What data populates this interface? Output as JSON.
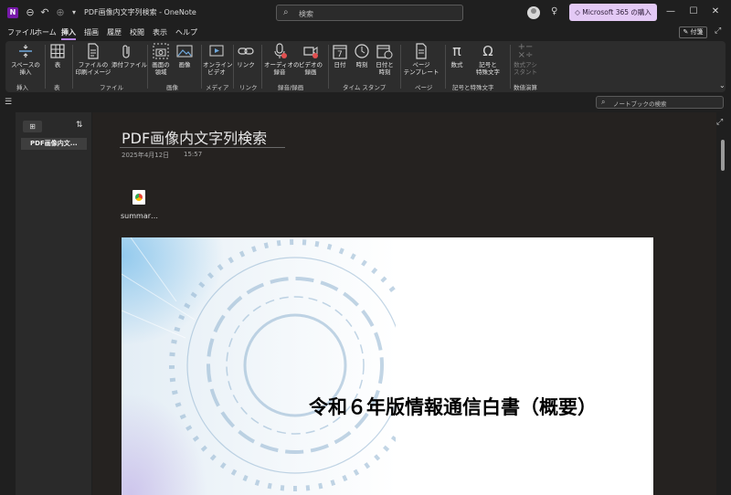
{
  "titlebar": {
    "doc_title": "PDF画像内文字列検索  -  OneNote",
    "search_placeholder": "検索",
    "buy_label": "Microsoft 365 の購入",
    "app_logo_letter": "N"
  },
  "menu": {
    "tabs": [
      "ファイル",
      "ホーム",
      "挿入",
      "描画",
      "履歴",
      "校閲",
      "表示",
      "ヘルプ"
    ],
    "active_tab": "挿入",
    "note_label": "付箋"
  },
  "ribbon": {
    "buttons": {
      "insert_space": "スペースの\n挿入",
      "table": "表",
      "printout": "ファイルの\n印刷イメージ",
      "attach": "添付ファイル",
      "screen_clip": "画面の\n領域",
      "picture": "画像",
      "online_video": "オンライン\nビデオ",
      "link": "リンク",
      "audio": "オーディオの\n録音",
      "video": "ビデオの\n録画",
      "date": "日付",
      "time": "時刻",
      "date_time": "日付と\n時刻",
      "page_template": "ページ\nテンプレート",
      "equation": "数式",
      "symbol": "記号と\n特殊文字",
      "ink_math": "数式アシ\nスタント"
    },
    "groups": {
      "insert": "挿入",
      "table": "表",
      "files": "ファイル",
      "images": "画像",
      "media": "メディア",
      "link": "リンク",
      "recording": "録音/録画",
      "timestamp": "タイム スタンプ",
      "pages": "ページ",
      "symbols": "記号と特殊文字",
      "math": "数値演算"
    }
  },
  "section_bar": {
    "notebook_search_placeholder": "ノートブックの検索"
  },
  "page_list": {
    "items": [
      "PDF画像内文..."
    ]
  },
  "page": {
    "title": "PDF画像内文字列検索",
    "date": "2025年4月12日",
    "time": "15:57",
    "attachment_name": "summar…",
    "pdf_heading": "令和６年版情報通信白書（概要）"
  },
  "colors": {
    "accent": "#b482e6",
    "buy_button": "#e3c9f5",
    "app_logo": "#7719aa"
  }
}
